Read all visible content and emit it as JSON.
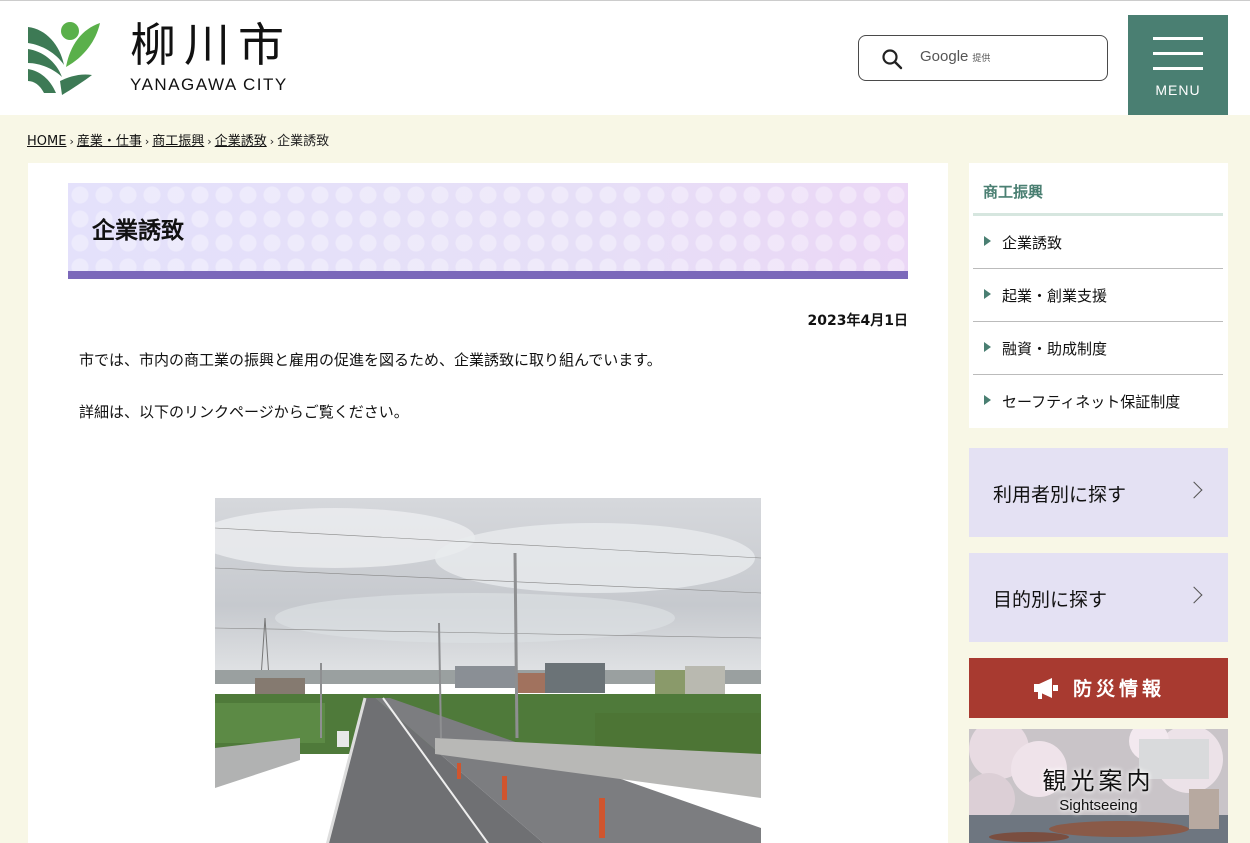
{
  "header": {
    "logo_jp": "柳川市",
    "logo_en": "YANAGAWA CITY",
    "search": {
      "brand": "Google",
      "suffix": "提供",
      "placeholder": ""
    },
    "menu_label": "MENU"
  },
  "breadcrumb": {
    "items": [
      "HOME",
      "産業・仕事",
      "商工振興",
      "企業誘致"
    ],
    "current": "企業誘致"
  },
  "main": {
    "title": "企業誘致",
    "date": "2023年4月1日",
    "paragraphs": [
      "市では、市内の商工業の振興と雇用の促進を図るため、企業誘致に取り組んでいます。",
      "詳細は、以下のリンクページからご覧ください。"
    ]
  },
  "sidebar": {
    "title": "商工振興",
    "items": [
      {
        "label": "企業誘致"
      },
      {
        "label": "起業・創業支援"
      },
      {
        "label": "融資・助成制度"
      },
      {
        "label": "セーフティネット保証制度"
      }
    ],
    "by_user": "利用者別に探す",
    "by_purpose": "目的別に探す",
    "disaster": "防災情報",
    "tourism_jp": "観光案内",
    "tourism_en": "Sightseeing"
  },
  "colors": {
    "brand_green": "#4a7f72",
    "title_border": "#7b68ba",
    "disaster_red": "#a83a30",
    "find_bg": "#e4e1f3"
  }
}
